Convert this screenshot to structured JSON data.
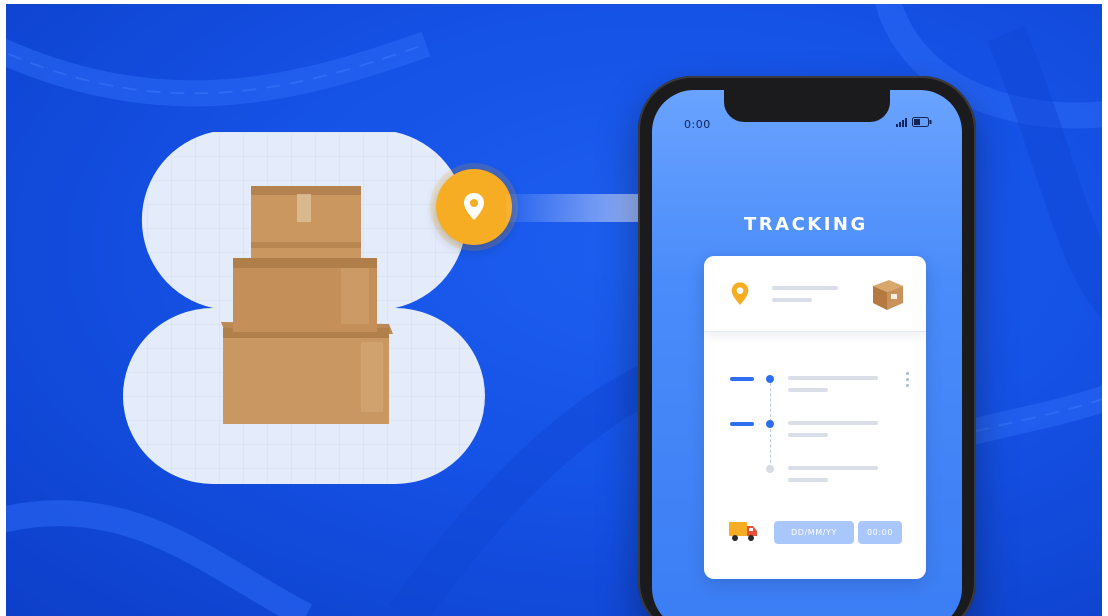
{
  "phone": {
    "status_time": "0:00",
    "title": "TRACKING",
    "date_placeholder": "DD/MM/YY",
    "time_placeholder": "00:00"
  },
  "colors": {
    "background": "#1552e6",
    "accent_orange": "#f6ad24",
    "accent_blue": "#2e6ff2",
    "box_cardboard": "#c99862"
  },
  "icons": [
    "location-pin-icon",
    "package-icon",
    "delivery-truck-icon",
    "signal-icon",
    "battery-icon",
    "more-vertical-icon"
  ]
}
